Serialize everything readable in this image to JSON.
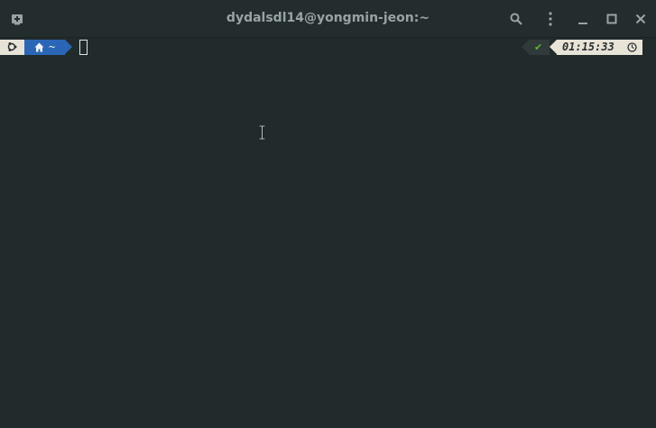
{
  "window": {
    "title": "dydalsdl14@yongmin-jeon:~",
    "icons": [
      "new-tab-icon",
      "search-icon",
      "menu-icon",
      "minimize-icon",
      "maximize-icon",
      "close-icon"
    ]
  },
  "prompt": {
    "os_icon": "ubuntu-icon",
    "home_icon": "home-icon",
    "directory": "~",
    "status_symbol": "✔",
    "time": "01:15:33",
    "clock_icon": "clock-icon"
  },
  "colors": {
    "background": "#212b2c",
    "titlebar": "#232d2e",
    "segment_light": "#e7e3d7",
    "segment_dir": "#2b66b6",
    "status_ok": "#62b12f"
  }
}
